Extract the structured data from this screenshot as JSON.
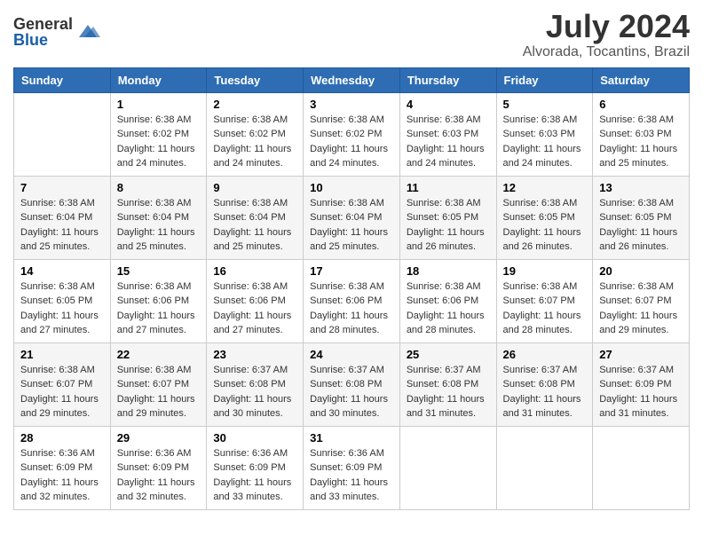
{
  "header": {
    "logo_general": "General",
    "logo_blue": "Blue",
    "month_title": "July 2024",
    "location": "Alvorada, Tocantins, Brazil"
  },
  "days_of_week": [
    "Sunday",
    "Monday",
    "Tuesday",
    "Wednesday",
    "Thursday",
    "Friday",
    "Saturday"
  ],
  "weeks": [
    [
      {
        "day": "",
        "sunrise": "",
        "sunset": "",
        "daylight": ""
      },
      {
        "day": "1",
        "sunrise": "6:38 AM",
        "sunset": "6:02 PM",
        "daylight": "11 hours and 24 minutes."
      },
      {
        "day": "2",
        "sunrise": "6:38 AM",
        "sunset": "6:02 PM",
        "daylight": "11 hours and 24 minutes."
      },
      {
        "day": "3",
        "sunrise": "6:38 AM",
        "sunset": "6:02 PM",
        "daylight": "11 hours and 24 minutes."
      },
      {
        "day": "4",
        "sunrise": "6:38 AM",
        "sunset": "6:03 PM",
        "daylight": "11 hours and 24 minutes."
      },
      {
        "day": "5",
        "sunrise": "6:38 AM",
        "sunset": "6:03 PM",
        "daylight": "11 hours and 24 minutes."
      },
      {
        "day": "6",
        "sunrise": "6:38 AM",
        "sunset": "6:03 PM",
        "daylight": "11 hours and 25 minutes."
      }
    ],
    [
      {
        "day": "7",
        "sunrise": "6:38 AM",
        "sunset": "6:04 PM",
        "daylight": "11 hours and 25 minutes."
      },
      {
        "day": "8",
        "sunrise": "6:38 AM",
        "sunset": "6:04 PM",
        "daylight": "11 hours and 25 minutes."
      },
      {
        "day": "9",
        "sunrise": "6:38 AM",
        "sunset": "6:04 PM",
        "daylight": "11 hours and 25 minutes."
      },
      {
        "day": "10",
        "sunrise": "6:38 AM",
        "sunset": "6:04 PM",
        "daylight": "11 hours and 25 minutes."
      },
      {
        "day": "11",
        "sunrise": "6:38 AM",
        "sunset": "6:05 PM",
        "daylight": "11 hours and 26 minutes."
      },
      {
        "day": "12",
        "sunrise": "6:38 AM",
        "sunset": "6:05 PM",
        "daylight": "11 hours and 26 minutes."
      },
      {
        "day": "13",
        "sunrise": "6:38 AM",
        "sunset": "6:05 PM",
        "daylight": "11 hours and 26 minutes."
      }
    ],
    [
      {
        "day": "14",
        "sunrise": "6:38 AM",
        "sunset": "6:05 PM",
        "daylight": "11 hours and 27 minutes."
      },
      {
        "day": "15",
        "sunrise": "6:38 AM",
        "sunset": "6:06 PM",
        "daylight": "11 hours and 27 minutes."
      },
      {
        "day": "16",
        "sunrise": "6:38 AM",
        "sunset": "6:06 PM",
        "daylight": "11 hours and 27 minutes."
      },
      {
        "day": "17",
        "sunrise": "6:38 AM",
        "sunset": "6:06 PM",
        "daylight": "11 hours and 28 minutes."
      },
      {
        "day": "18",
        "sunrise": "6:38 AM",
        "sunset": "6:06 PM",
        "daylight": "11 hours and 28 minutes."
      },
      {
        "day": "19",
        "sunrise": "6:38 AM",
        "sunset": "6:07 PM",
        "daylight": "11 hours and 28 minutes."
      },
      {
        "day": "20",
        "sunrise": "6:38 AM",
        "sunset": "6:07 PM",
        "daylight": "11 hours and 29 minutes."
      }
    ],
    [
      {
        "day": "21",
        "sunrise": "6:38 AM",
        "sunset": "6:07 PM",
        "daylight": "11 hours and 29 minutes."
      },
      {
        "day": "22",
        "sunrise": "6:38 AM",
        "sunset": "6:07 PM",
        "daylight": "11 hours and 29 minutes."
      },
      {
        "day": "23",
        "sunrise": "6:37 AM",
        "sunset": "6:08 PM",
        "daylight": "11 hours and 30 minutes."
      },
      {
        "day": "24",
        "sunrise": "6:37 AM",
        "sunset": "6:08 PM",
        "daylight": "11 hours and 30 minutes."
      },
      {
        "day": "25",
        "sunrise": "6:37 AM",
        "sunset": "6:08 PM",
        "daylight": "11 hours and 31 minutes."
      },
      {
        "day": "26",
        "sunrise": "6:37 AM",
        "sunset": "6:08 PM",
        "daylight": "11 hours and 31 minutes."
      },
      {
        "day": "27",
        "sunrise": "6:37 AM",
        "sunset": "6:09 PM",
        "daylight": "11 hours and 31 minutes."
      }
    ],
    [
      {
        "day": "28",
        "sunrise": "6:36 AM",
        "sunset": "6:09 PM",
        "daylight": "11 hours and 32 minutes."
      },
      {
        "day": "29",
        "sunrise": "6:36 AM",
        "sunset": "6:09 PM",
        "daylight": "11 hours and 32 minutes."
      },
      {
        "day": "30",
        "sunrise": "6:36 AM",
        "sunset": "6:09 PM",
        "daylight": "11 hours and 33 minutes."
      },
      {
        "day": "31",
        "sunrise": "6:36 AM",
        "sunset": "6:09 PM",
        "daylight": "11 hours and 33 minutes."
      },
      {
        "day": "",
        "sunrise": "",
        "sunset": "",
        "daylight": ""
      },
      {
        "day": "",
        "sunrise": "",
        "sunset": "",
        "daylight": ""
      },
      {
        "day": "",
        "sunrise": "",
        "sunset": "",
        "daylight": ""
      }
    ]
  ],
  "labels": {
    "sunrise_prefix": "Sunrise: ",
    "sunset_prefix": "Sunset: ",
    "daylight_prefix": "Daylight: "
  }
}
